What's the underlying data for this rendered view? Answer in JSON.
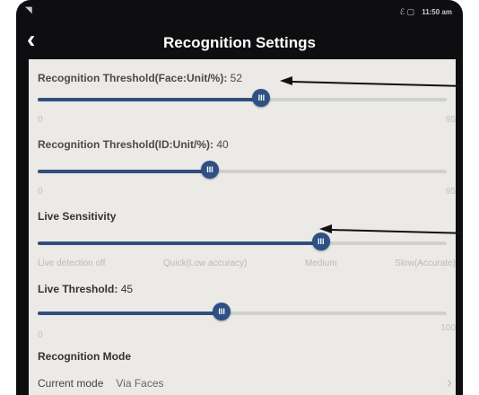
{
  "status_bar": {
    "left_icon": "signal-icon",
    "right_icons": "ℰ ▢",
    "time": "11:50 am"
  },
  "header": {
    "back_icon": "back-chevron-icon",
    "title": "Recognition Settings"
  },
  "face_threshold": {
    "label": "Recognition Threshold(Face:Unit/%): ",
    "value": "52",
    "min": "0",
    "max": "95",
    "level": 0.547
  },
  "id_threshold": {
    "label": "Recognition Threshold(ID:Unit/%): ",
    "value": "40",
    "min": "0",
    "max": "95",
    "level": 0.421
  },
  "live_sensitivity": {
    "label": "Live Sensitivity",
    "options": [
      "Live detection off",
      "Quick(Low accuracy)",
      "Medium",
      "Slow(Accurate)"
    ],
    "selected": "Medium"
  },
  "live_threshold": {
    "label": "Live Threshold: ",
    "value": "45",
    "min": "0",
    "max": "100",
    "level": 0.45
  },
  "recognition_mode": {
    "label": "Recognition Mode",
    "current_label": "Current mode",
    "current_value": "Via Faces"
  },
  "thumb_glyph": "III",
  "chevron_glyph": "›"
}
